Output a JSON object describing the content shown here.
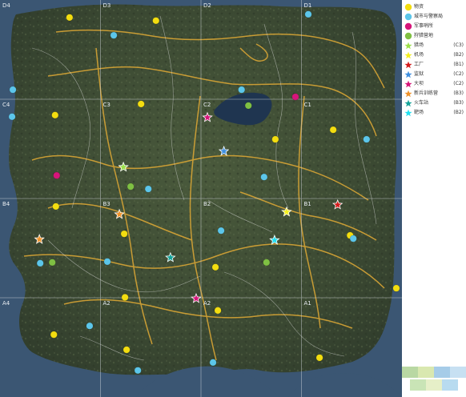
{
  "grid": {
    "columns": [
      "A",
      "B",
      "C",
      "D"
    ],
    "rows": [
      "1",
      "2",
      "3",
      "4"
    ],
    "cell_labels": {
      "col_label_row_top": [
        "D4",
        "D3",
        "D2",
        "D1"
      ],
      "row2": [
        "C4",
        "C3",
        "C2",
        "C1"
      ],
      "row3": [
        "B4",
        "B3",
        "B2",
        "B1"
      ],
      "row4": [
        "A4",
        "A2",
        "A2",
        "A1"
      ]
    }
  },
  "legend": {
    "items": [
      {
        "label": "物资",
        "code": "",
        "symbol": "dot",
        "color": "#f3dd10"
      },
      {
        "label": "城市与警察局",
        "code": "",
        "symbol": "dot",
        "color": "#5cc6ea"
      },
      {
        "label": "军事哨所",
        "code": "",
        "symbol": "dot",
        "color": "#d6157a"
      },
      {
        "label": "狩猎营地",
        "code": "",
        "symbol": "dot",
        "color": "#7fc043"
      },
      {
        "label": "猎场",
        "code": "(C3)",
        "symbol": "star",
        "color": "#9be04a"
      },
      {
        "label": "机场",
        "code": "(B2)",
        "symbol": "star",
        "color": "#f3f020"
      },
      {
        "label": "工厂",
        "code": "(B1)",
        "symbol": "star",
        "color": "#d41c1c"
      },
      {
        "label": "监狱",
        "code": "(C2)",
        "symbol": "star",
        "color": "#3e8fe0"
      },
      {
        "label": "大坝",
        "code": "(C2)",
        "symbol": "star",
        "color": "#d6157a"
      },
      {
        "label": "新兵训练营",
        "code": "(B3)",
        "symbol": "star",
        "color": "#f0932a"
      },
      {
        "label": "火车站",
        "code": "(B3)",
        "symbol": "star",
        "color": "#14a39a"
      },
      {
        "label": "靶场",
        "code": "(B2)",
        "symbol": "star",
        "color": "#22e0f0"
      }
    ]
  },
  "markers": [
    {
      "kind": "supply",
      "x": 0.173,
      "y": 0.044
    },
    {
      "kind": "supply",
      "x": 0.388,
      "y": 0.052
    },
    {
      "kind": "supply",
      "x": 0.351,
      "y": 0.262
    },
    {
      "kind": "supply",
      "x": 0.137,
      "y": 0.29
    },
    {
      "kind": "supply",
      "x": 0.685,
      "y": 0.351
    },
    {
      "kind": "supply",
      "x": 0.829,
      "y": 0.327
    },
    {
      "kind": "supply",
      "x": 0.139,
      "y": 0.52
    },
    {
      "kind": "supply",
      "x": 0.309,
      "y": 0.589
    },
    {
      "kind": "supply",
      "x": 0.871,
      "y": 0.593
    },
    {
      "kind": "supply",
      "x": 0.986,
      "y": 0.726
    },
    {
      "kind": "supply",
      "x": 0.536,
      "y": 0.673
    },
    {
      "kind": "supply",
      "x": 0.311,
      "y": 0.749
    },
    {
      "kind": "supply",
      "x": 0.542,
      "y": 0.782
    },
    {
      "kind": "supply",
      "x": 0.134,
      "y": 0.843
    },
    {
      "kind": "supply",
      "x": 0.315,
      "y": 0.881
    },
    {
      "kind": "supply",
      "x": 0.795,
      "y": 0.901
    },
    {
      "kind": "city",
      "x": 0.283,
      "y": 0.089
    },
    {
      "kind": "city",
      "x": 0.767,
      "y": 0.036
    },
    {
      "kind": "city",
      "x": 0.032,
      "y": 0.226
    },
    {
      "kind": "city",
      "x": 0.03,
      "y": 0.294
    },
    {
      "kind": "city",
      "x": 0.601,
      "y": 0.226
    },
    {
      "kind": "city",
      "x": 0.912,
      "y": 0.351
    },
    {
      "kind": "city",
      "x": 0.369,
      "y": 0.476
    },
    {
      "kind": "city",
      "x": 0.657,
      "y": 0.446
    },
    {
      "kind": "city",
      "x": 0.55,
      "y": 0.581
    },
    {
      "kind": "city",
      "x": 0.879,
      "y": 0.601
    },
    {
      "kind": "city",
      "x": 0.1,
      "y": 0.663
    },
    {
      "kind": "city",
      "x": 0.267,
      "y": 0.659
    },
    {
      "kind": "city",
      "x": 0.223,
      "y": 0.821
    },
    {
      "kind": "city",
      "x": 0.343,
      "y": 0.933
    },
    {
      "kind": "city",
      "x": 0.53,
      "y": 0.913
    },
    {
      "kind": "military",
      "x": 0.735,
      "y": 0.244
    },
    {
      "kind": "military",
      "x": 0.141,
      "y": 0.442
    },
    {
      "kind": "hunting",
      "x": 0.618,
      "y": 0.266
    },
    {
      "kind": "hunting",
      "x": 0.325,
      "y": 0.47
    },
    {
      "kind": "hunting",
      "x": 0.13,
      "y": 0.661
    },
    {
      "kind": "hunting",
      "x": 0.663,
      "y": 0.661
    },
    {
      "kind": "star-hunting-ground",
      "x": 0.307,
      "y": 0.421
    },
    {
      "kind": "star-airport",
      "x": 0.713,
      "y": 0.534
    },
    {
      "kind": "star-factory",
      "x": 0.84,
      "y": 0.516
    },
    {
      "kind": "star-prison",
      "x": 0.557,
      "y": 0.381
    },
    {
      "kind": "star-dam",
      "x": 0.516,
      "y": 0.296
    },
    {
      "kind": "star-dam",
      "x": 0.488,
      "y": 0.752
    },
    {
      "kind": "star-bootcamp",
      "x": 0.297,
      "y": 0.54
    },
    {
      "kind": "star-bootcamp",
      "x": 0.098,
      "y": 0.603
    },
    {
      "kind": "star-trainstation",
      "x": 0.424,
      "y": 0.649
    },
    {
      "kind": "star-range",
      "x": 0.683,
      "y": 0.605
    }
  ]
}
